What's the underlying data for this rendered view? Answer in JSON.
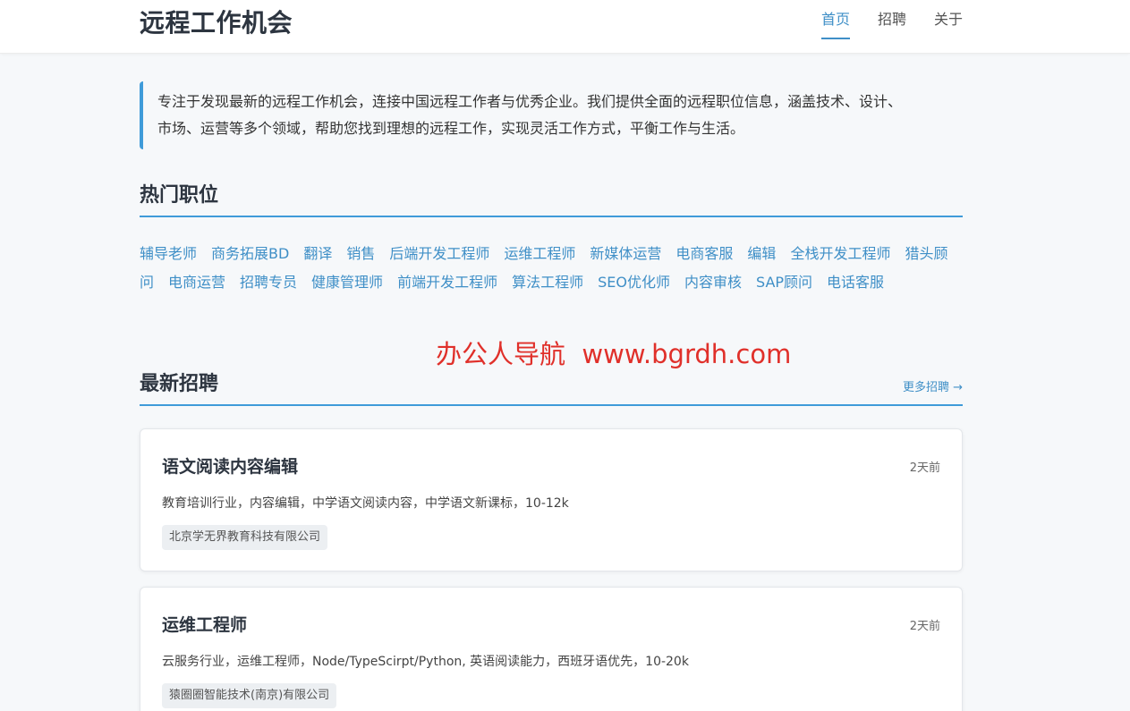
{
  "header": {
    "site_title": "远程工作机会",
    "nav": [
      {
        "label": "首页",
        "active": true
      },
      {
        "label": "招聘",
        "active": false
      },
      {
        "label": "关于",
        "active": false
      }
    ]
  },
  "intro": {
    "line1": "专注于发现最新的远程工作机会，连接中国远程工作者与优秀企业。我们提供全面的远程职位信息，涵盖技术、设计、",
    "line2": "市场、运营等多个领域，帮助您找到理想的远程工作，实现灵活工作方式，平衡工作与生活。"
  },
  "hot_positions": {
    "title": "热门职位",
    "tags": [
      "辅导老师",
      "商务拓展BD",
      "翻译",
      "销售",
      "后端开发工程师",
      "运维工程师",
      "新媒体运营",
      "电商客服",
      "编辑",
      "全栈开发工程师",
      "猎头顾问",
      "电商运营",
      "招聘专员",
      "健康管理师",
      "前端开发工程师",
      "算法工程师",
      "SEO优化师",
      "内容审核",
      "SAP顾问",
      "电话客服"
    ]
  },
  "watermark": "办公人导航  www.bgrdh.com",
  "latest_jobs": {
    "title": "最新招聘",
    "more_label": "更多招聘 →",
    "jobs": [
      {
        "title": "语文阅读内容编辑",
        "time": "2天前",
        "desc": "教育培训行业，内容编辑，中学语文阅读内容，中学语文新课标，10-12k",
        "company": "北京学无界教育科技有限公司"
      },
      {
        "title": "运维工程师",
        "time": "2天前",
        "desc": "云服务行业，运维工程师，Node/TypeScirpt/Python, 英语阅读能力，西班牙语优先，10-20k",
        "company": "猿圈圈智能技术(南京)有限公司"
      }
    ]
  },
  "colors": {
    "accent": "#3f8fc7",
    "accent_border": "#3f9bd9",
    "watermark": "#e0302a",
    "background": "#f6f8fa"
  }
}
